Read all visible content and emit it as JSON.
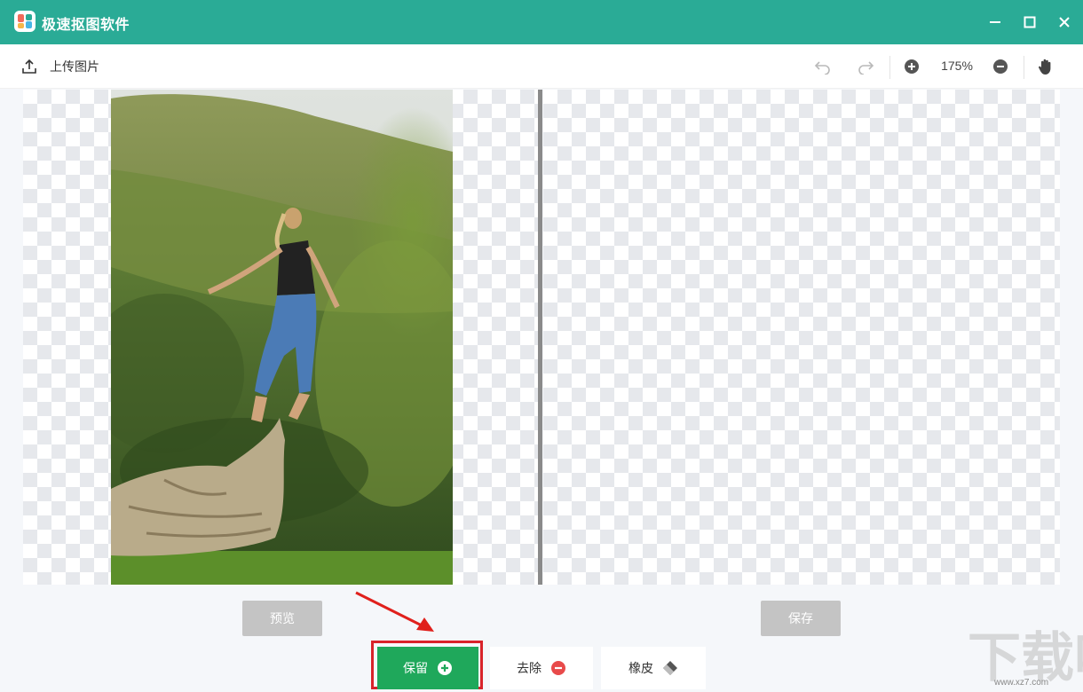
{
  "window": {
    "title": "极速抠图软件"
  },
  "toolbar": {
    "upload_label": "上传图片",
    "zoom_level": "175%"
  },
  "actions": {
    "preview_label": "预览",
    "save_label": "保存"
  },
  "tools": {
    "keep_label": "保留",
    "remove_label": "去除",
    "eraser_label": "橡皮"
  },
  "colors": {
    "titlebar": "#2aab96",
    "keep_button": "#1fa85b",
    "highlight_box": "#d8232a",
    "remove_icon": "#e84a4a"
  },
  "icons": [
    "app-logo",
    "upload-icon",
    "undo-icon",
    "redo-icon",
    "zoom-in-icon",
    "zoom-out-icon",
    "hand-icon",
    "minimize-icon",
    "maximize-icon",
    "close-icon",
    "plus-circle-icon",
    "minus-circle-icon",
    "eraser-icon"
  ],
  "watermark": {
    "text": "www.xz7.com"
  }
}
